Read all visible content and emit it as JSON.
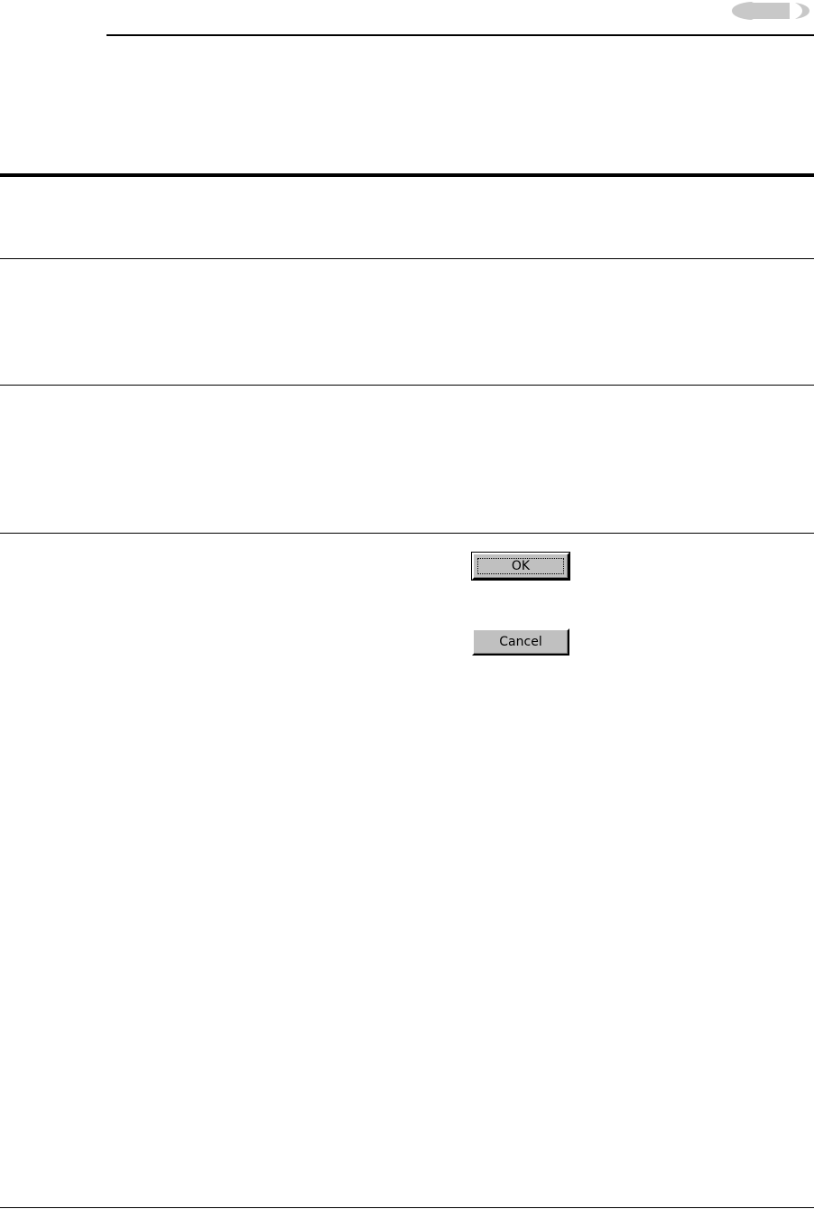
{
  "logo": {
    "icon": "logo-mark-icon",
    "color": "#c8c8c8"
  },
  "dialog": {
    "ok_label": "OK",
    "cancel_label": "Cancel",
    "button_face_color": "#c0c0c0"
  }
}
